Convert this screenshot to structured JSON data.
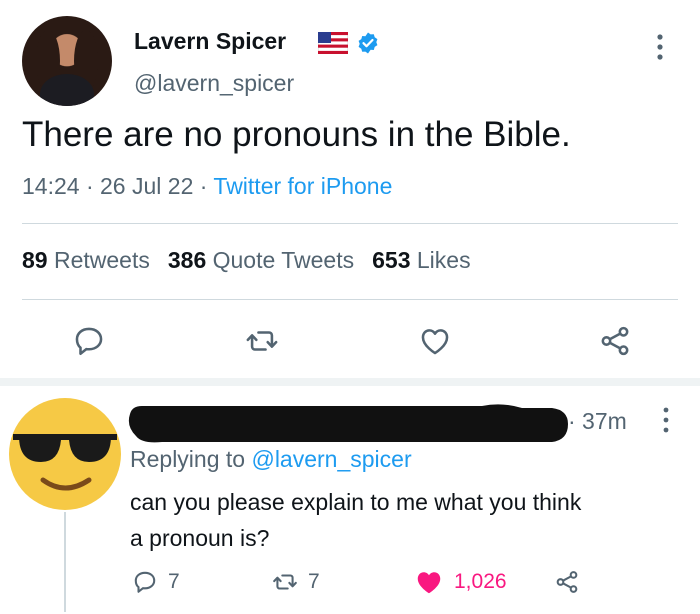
{
  "tweet": {
    "author_name": "Lavern Spicer",
    "author_handle": "@lavern_spicer",
    "text": "There are no pronouns in the Bible.",
    "time": "14:24",
    "date": "26 Jul 22",
    "source": "Twitter for iPhone",
    "retweets_count": "89",
    "retweets_label": "Retweets",
    "quote_count": "386",
    "quote_label": "Quote Tweets",
    "likes_count": "653",
    "likes_label": "Likes",
    "dot": "·"
  },
  "reply": {
    "time": "· 37m",
    "replying_prefix": "Replying to",
    "replying_handle": "@lavern_spicer",
    "text_line1": "can you please explain to me what you think",
    "text_line2": "a pronoun is?",
    "reply_count": "7",
    "retweet_count": "7",
    "like_count": "1,026"
  },
  "colors": {
    "accent": "#1d9bf0",
    "like": "#f91880",
    "muted": "#536471",
    "divider": "#cfd9de"
  },
  "icons": {
    "reply": "reply-icon",
    "retweet": "retweet-icon",
    "like": "heart-icon",
    "share": "share-icon",
    "verified": "verified-badge-icon",
    "flag": "us-flag-icon",
    "more": "more-vertical-icon"
  }
}
